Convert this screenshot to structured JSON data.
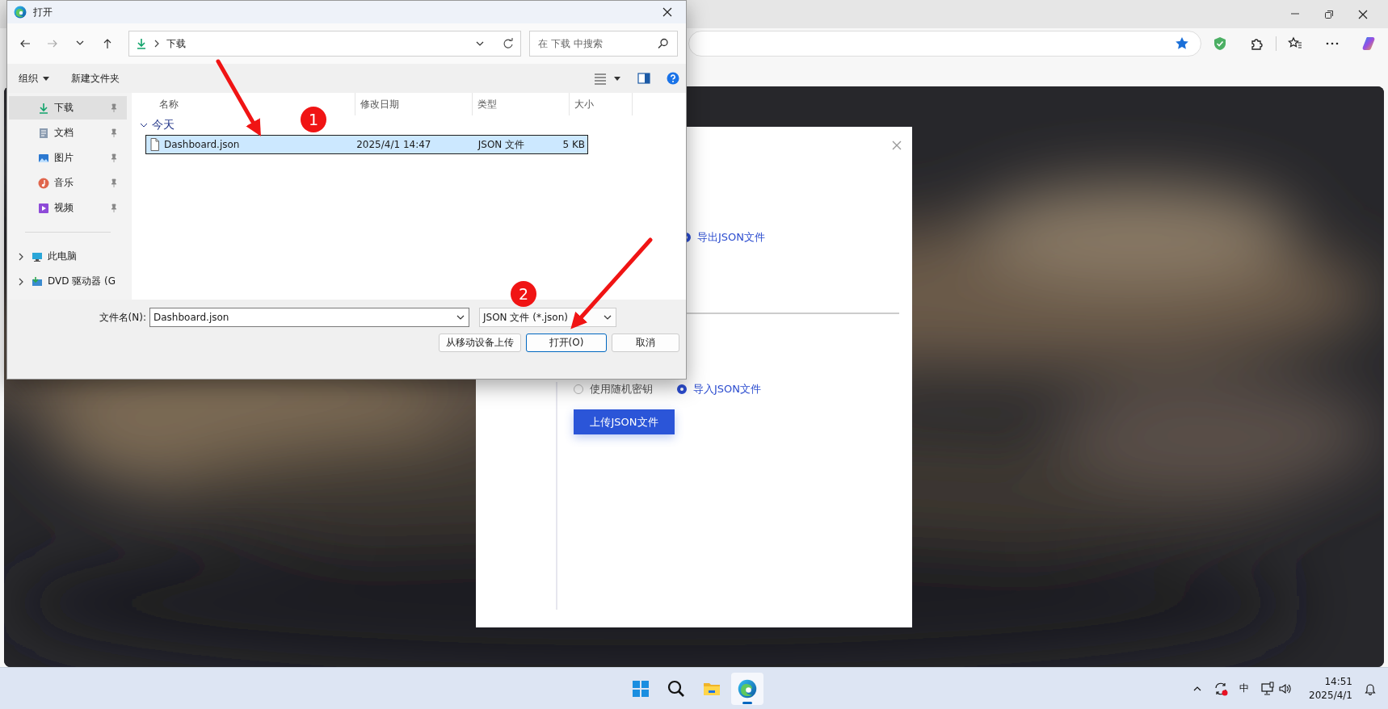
{
  "file_dialog": {
    "title": "打开",
    "path": "下载",
    "search_placeholder": "在 下载 中搜索",
    "toolbar": [
      "组织",
      "新建文件夹"
    ],
    "sidebar": [
      {
        "label": "下载",
        "kind": "downloads",
        "selected": true,
        "pinned": true
      },
      {
        "label": "文档",
        "kind": "documents",
        "selected": false,
        "pinned": true
      },
      {
        "label": "图片",
        "kind": "pictures",
        "selected": false,
        "pinned": true
      },
      {
        "label": "音乐",
        "kind": "music",
        "selected": false,
        "pinned": true
      },
      {
        "label": "视频",
        "kind": "videos",
        "selected": false,
        "pinned": true
      },
      {
        "label": "此电脑",
        "kind": "computer",
        "selected": false,
        "expanded": false
      },
      {
        "label": "DVD 驱动器 (G",
        "kind": "drive",
        "selected": false,
        "expanded": false
      }
    ],
    "columns": [
      "名称",
      "修改日期",
      "类型",
      "大小"
    ],
    "groups": [
      {
        "label": "今天",
        "expanded": true,
        "files": [
          {
            "name": "Dashboard.json",
            "modified": "2025/4/1 14:47",
            "type": "JSON 文件",
            "size": "5 KB",
            "selected": true
          }
        ]
      }
    ],
    "filename_label": "文件名(N):",
    "filename": "Dashboard.json",
    "filetype": "JSON 文件 (*.json)",
    "buttons": [
      {
        "label": "从移动设备上传",
        "default": false
      },
      {
        "label": "打开(O)",
        "default": true
      },
      {
        "label": "取消",
        "default": false
      }
    ]
  },
  "web_modal": {
    "export_option": {
      "label": "导出JSON文件",
      "selected": true
    },
    "import_options": [
      {
        "label": "使用随机密钥",
        "selected": false
      },
      {
        "label": "导入JSON文件",
        "selected": true
      }
    ],
    "upload_button": "上传JSON文件"
  },
  "annotations": [
    {
      "label": "1"
    },
    {
      "label": "2"
    }
  ],
  "taskbar": {
    "apps": [
      {
        "kind": "start",
        "selected": false
      },
      {
        "kind": "search",
        "selected": false
      },
      {
        "kind": "explorer",
        "selected": false
      },
      {
        "kind": "browser",
        "selected": true
      }
    ],
    "ime": "中",
    "time": "14:51",
    "date": "2025/4/1"
  }
}
